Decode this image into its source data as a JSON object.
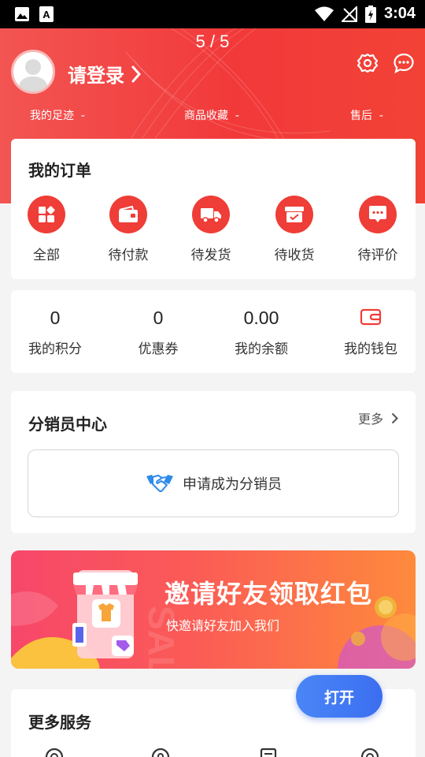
{
  "status_bar": {
    "time": "3:04"
  },
  "header": {
    "page_indicator": "5 / 5",
    "login_label": "请登录",
    "stats": [
      {
        "label": "我的足迹",
        "value": "-"
      },
      {
        "label": "商品收藏",
        "value": "-"
      },
      {
        "label": "售后",
        "value": "-"
      }
    ],
    "icons": [
      "settings-icon",
      "message-icon"
    ]
  },
  "orders": {
    "title": "我的订单",
    "items": [
      {
        "label": "全部",
        "icon": "grid-icon"
      },
      {
        "label": "待付款",
        "icon": "wallet-icon"
      },
      {
        "label": "待发货",
        "icon": "truck-icon"
      },
      {
        "label": "待收货",
        "icon": "box-icon"
      },
      {
        "label": "待评价",
        "icon": "chat-icon"
      }
    ]
  },
  "assets": {
    "items": [
      {
        "value": "0",
        "label": "我的积分"
      },
      {
        "value": "0",
        "label": "优惠券"
      },
      {
        "value": "0.00",
        "label": "我的余额"
      },
      {
        "value": "",
        "label": "我的钱包"
      }
    ]
  },
  "distributor": {
    "title": "分销员中心",
    "more_label": "更多",
    "apply_label": "申请成为分销员"
  },
  "banner": {
    "title": "邀请好友领取红包",
    "subtitle": "快邀请好友加入我们"
  },
  "services": {
    "title": "更多服务"
  },
  "float_button": {
    "label": "打开"
  },
  "colors": {
    "primary": "#ef3d37",
    "button_blue": "#3b6ef0"
  }
}
